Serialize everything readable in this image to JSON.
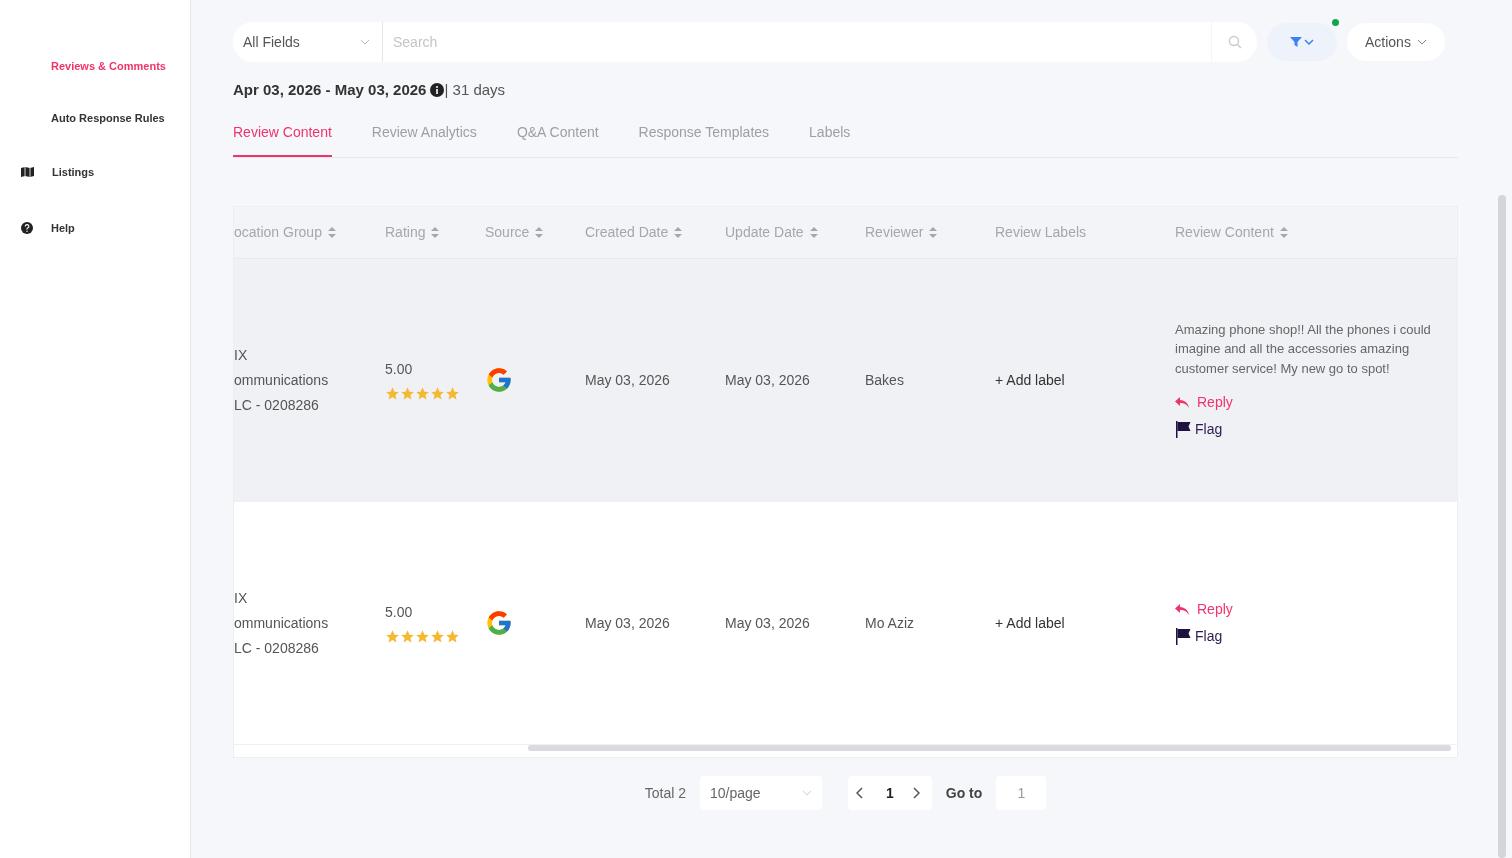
{
  "sidebar": {
    "items": [
      {
        "label": "Reviews & Comments",
        "kind": "subitem",
        "selected": true
      },
      {
        "label": "Auto Response Rules",
        "kind": "subitem",
        "selected": false
      },
      {
        "label": "Listings",
        "kind": "map",
        "selected": false
      },
      {
        "label": "Help",
        "kind": "help",
        "selected": false
      }
    ]
  },
  "toolbar": {
    "field_select": "All Fields",
    "search": {
      "placeholder": "Search"
    },
    "filter_active": true,
    "actions": "Actions"
  },
  "date_range": {
    "range": "Apr 03, 2026 - May 03, 2026",
    "days": "| 31 days"
  },
  "tabs": [
    {
      "label": "Review Content",
      "selected": true
    },
    {
      "label": "Review Analytics",
      "selected": false
    },
    {
      "label": "Q&A Content",
      "selected": false
    },
    {
      "label": "Response Templates",
      "selected": false
    },
    {
      "label": "Labels",
      "selected": false
    }
  ],
  "table": {
    "columns": [
      {
        "label": "ocation Group",
        "sortable": true
      },
      {
        "label": "Rating",
        "sortable": true
      },
      {
        "label": "Source",
        "sortable": true
      },
      {
        "label": "Created Date",
        "sortable": true
      },
      {
        "label": "Update Date",
        "sortable": true
      },
      {
        "label": "Reviewer",
        "sortable": true
      },
      {
        "label": "Review Labels",
        "sortable": false
      },
      {
        "label": "Review Content",
        "sortable": true
      }
    ],
    "rows": [
      {
        "hovered": true,
        "location": [
          "IX",
          "ommunications",
          "LC - 0208286"
        ],
        "rating": "5.00",
        "stars": 5,
        "created": "May 03, 2026",
        "updated": "May 03, 2026",
        "reviewer": "Bakes",
        "add_label": "+ Add label",
        "content": "Amazing phone shop!! All the phones i could imagine and all the accessories amazing customer service! My new go to spot!",
        "reply": "Reply",
        "flag": "Flag"
      },
      {
        "hovered": false,
        "location": [
          "IX",
          "ommunications",
          "LC - 0208286"
        ],
        "rating": "5.00",
        "stars": 5,
        "created": "May 03, 2026",
        "updated": "May 03, 2026",
        "reviewer": "Mo Aziz",
        "add_label": "+ Add label",
        "reply": "Reply",
        "flag": "Flag"
      }
    ]
  },
  "pagination": {
    "total": "Total 2",
    "page_size": "10/page",
    "current_page": "1",
    "goto_label": "Go to",
    "goto_value": "1"
  }
}
